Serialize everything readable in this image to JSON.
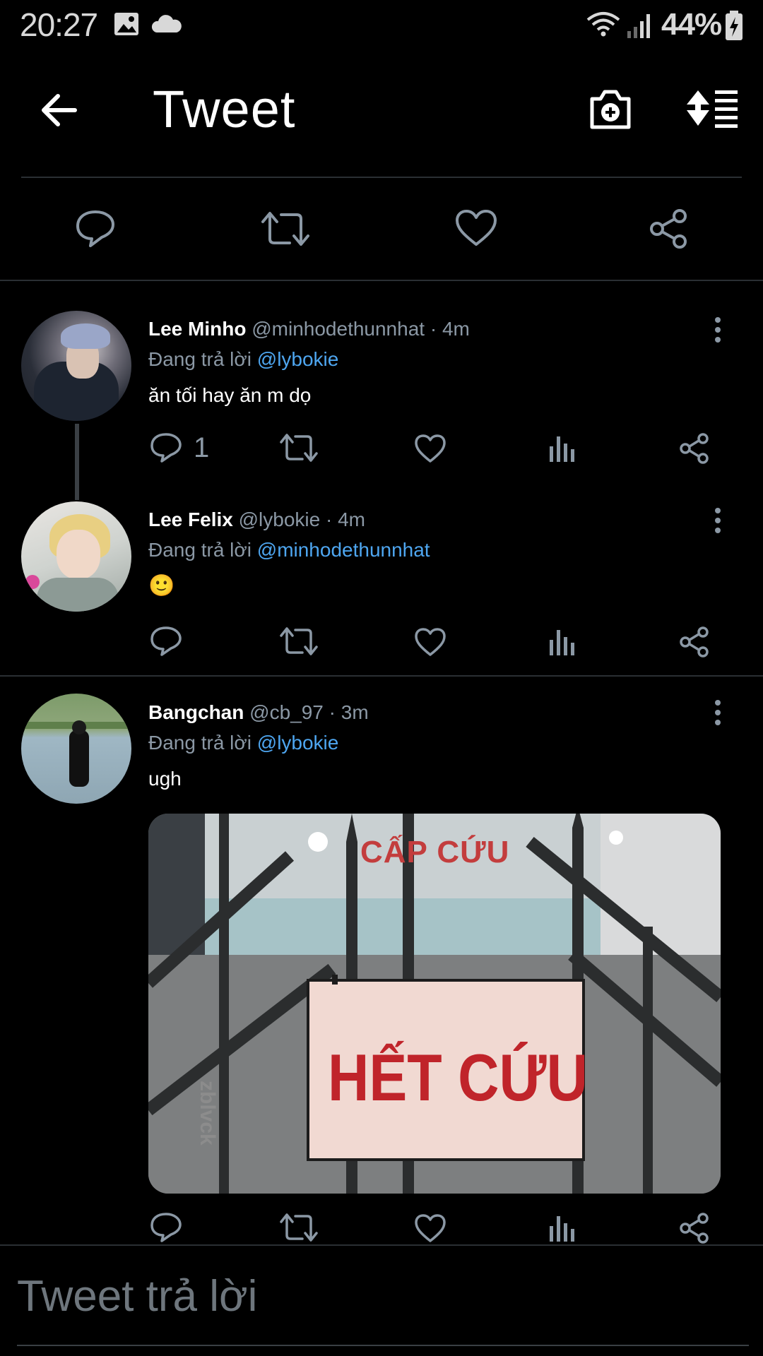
{
  "status_bar": {
    "time": "20:27",
    "battery": "44%"
  },
  "header": {
    "title": "Tweet"
  },
  "tweets": [
    {
      "name": "Lee Minho",
      "handle": "@minhodethunnhat",
      "time": "4m",
      "replying_label": "Đang trả lời",
      "replying_to": "@lybokie",
      "text": "ăn tối hay ăn m dọ",
      "reply_count": "1"
    },
    {
      "name": "Lee Felix",
      "handle": "@lybokie",
      "time": "4m",
      "replying_label": "Đang trả lời",
      "replying_to": "@minhodethunnhat",
      "text": "🙂",
      "reply_count": ""
    },
    {
      "name": "Bangchan",
      "handle": "@cb_97",
      "time": "3m",
      "replying_label": "Đang trả lời",
      "replying_to": "@lybokie",
      "text": "ugh",
      "reply_count": "",
      "image_sign_top": "CẤP CỨU",
      "image_sign_main": "HẾT CỨU",
      "image_watermark": "zblvck"
    }
  ],
  "compose": {
    "placeholder": "Tweet trả lời"
  },
  "icons": {
    "back": "arrow-left-icon",
    "camera": "camera-plus-icon",
    "sort": "sort-icon",
    "reply": "reply-icon",
    "retweet": "retweet-icon",
    "like": "heart-icon",
    "share": "share-icon",
    "stats": "analytics-icon",
    "more": "more-vertical-icon"
  },
  "colors": {
    "background": "#000000",
    "muted": "#8b98a5",
    "link": "#4ea6f0",
    "divider": "#2a2f33"
  }
}
